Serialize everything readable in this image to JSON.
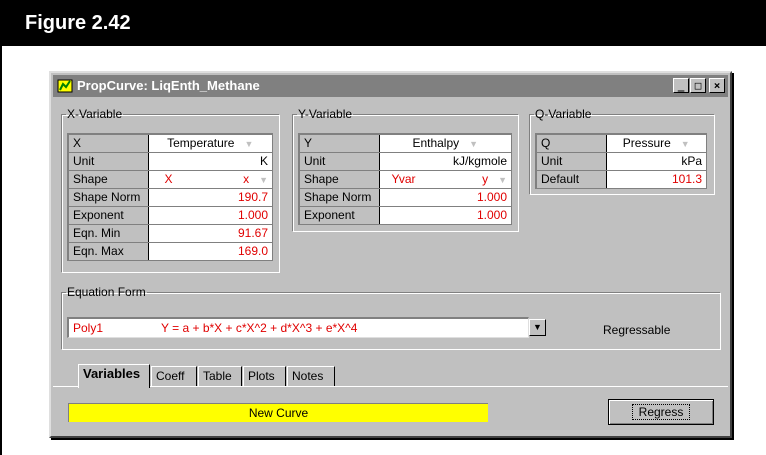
{
  "figure": {
    "title": "Figure 2.42"
  },
  "window": {
    "title": "PropCurve: LiqEnth_Methane",
    "controls": {
      "minimize": "_",
      "maximize": "□",
      "close": "×"
    }
  },
  "x_variable": {
    "legend": "X-Variable",
    "rows": [
      {
        "label": "X",
        "value": "Temperature",
        "dropdown": true
      },
      {
        "label": "Unit",
        "value": "K"
      },
      {
        "label": "Shape",
        "value_left": "X",
        "value": "x",
        "dropdown": true,
        "red": true
      },
      {
        "label": "Shape Norm",
        "value": "190.7",
        "red": true
      },
      {
        "label": "Exponent",
        "value": "1.000",
        "red": true
      },
      {
        "label": "Eqn. Min",
        "value": "91.67",
        "red": true
      },
      {
        "label": "Eqn. Max",
        "value": "169.0",
        "red": true
      }
    ]
  },
  "y_variable": {
    "legend": "Y-Variable",
    "rows": [
      {
        "label": "Y",
        "value": "Enthalpy",
        "dropdown": true
      },
      {
        "label": "Unit",
        "value": "kJ/kgmole"
      },
      {
        "label": "Shape",
        "value_left": "Yvar",
        "value": "y",
        "dropdown": true,
        "red": true
      },
      {
        "label": "Shape Norm",
        "value": "1.000",
        "red": true
      },
      {
        "label": "Exponent",
        "value": "1.000",
        "red": true
      }
    ]
  },
  "q_variable": {
    "legend": "Q-Variable",
    "rows": [
      {
        "label": "Q",
        "value": "Pressure",
        "dropdown": true
      },
      {
        "label": "Unit",
        "value": "kPa"
      },
      {
        "label": "Default",
        "value": "101.3",
        "red": true
      }
    ]
  },
  "equation_form": {
    "legend": "Equation Form",
    "name": "Poly1",
    "formula": "Y = a + b*X + c*X^2 + d*X^3 + e*X^4",
    "status": "Regressable"
  },
  "tabs": [
    {
      "label": "Variables",
      "active": true
    },
    {
      "label": "Coeff"
    },
    {
      "label": "Table"
    },
    {
      "label": "Plots"
    },
    {
      "label": "Notes"
    }
  ],
  "status_text": "New Curve",
  "regress_label": "Regress",
  "colors": {
    "status_bg": "#ffff00",
    "value_red": "#e00000",
    "dialog_bg": "#c0c0c0",
    "title_bar": "#808080"
  }
}
